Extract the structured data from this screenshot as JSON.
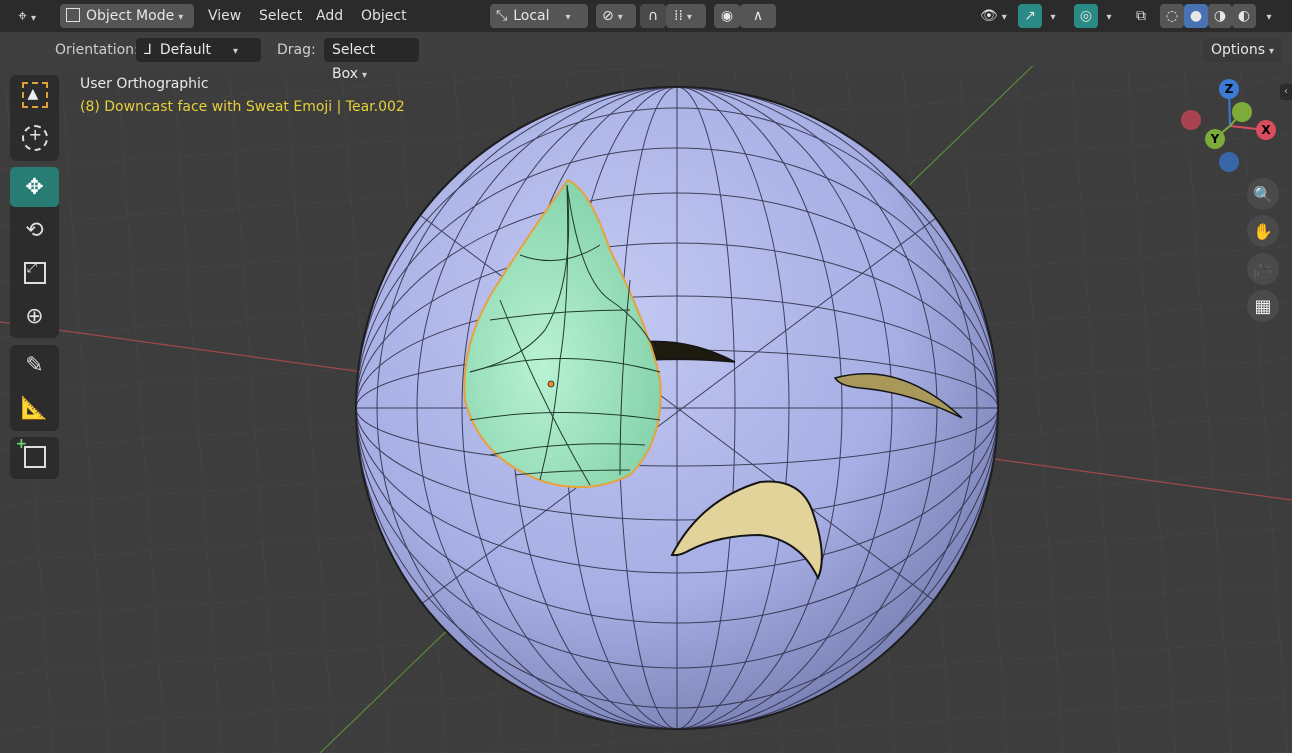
{
  "header": {
    "editor_type_icon": "viewport-3d-icon",
    "mode": "Object Mode",
    "menus": [
      "View",
      "Select",
      "Add",
      "Object"
    ],
    "transform_orientation": "Local",
    "options_label": "Options"
  },
  "toolheader": {
    "orientation_label": "Orientation:",
    "orientation_value": "Default",
    "drag_label": "Drag:",
    "drag_value": "Select Box"
  },
  "viewport": {
    "view_name": "User Orthographic",
    "object_info": "(8) Downcast face with Sweat Emoji | Tear.002",
    "info_color": "#e6d03a",
    "mesh_color": "#aab3e8",
    "selected_mesh_color": "#a6e8c2",
    "grid_axis_x_color": "#b04a4a",
    "grid_axis_y_color": "#5e8a3c"
  },
  "tools": [
    "select-box-icon",
    "cursor-icon",
    "move-icon",
    "rotate-icon",
    "scale-icon",
    "transform-icon",
    "annotate-icon",
    "measure-icon",
    "add-cube-icon"
  ],
  "gizmo": {
    "z": "Z",
    "y": "Y",
    "x": "X"
  },
  "navigation": [
    "zoom-icon",
    "pan-hand-icon",
    "camera-icon",
    "grid-perspective-icon"
  ]
}
